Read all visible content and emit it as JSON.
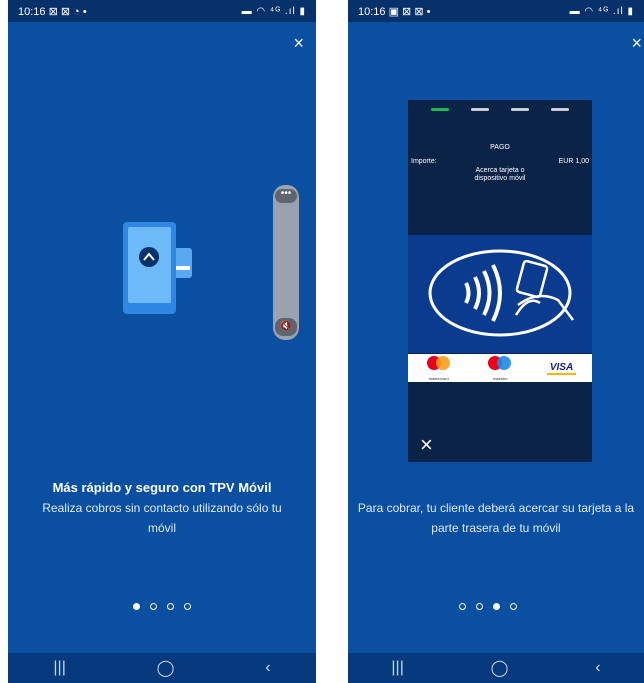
{
  "left": {
    "status": {
      "time": "10:16",
      "left_icons": "⊠ ⊠ ◔ •",
      "right_icons": "▬ ◠ ⁴ᴳ .ıl ▮"
    },
    "title": "Más rápido y seguro con TPV Móvil",
    "subtitle": "Realiza cobros sin contacto utilizando sólo tu móvil",
    "dots": {
      "total": 4,
      "active": 1
    },
    "side_panel": {
      "more_label": "•••",
      "mute_label": "🔇"
    }
  },
  "right": {
    "status": {
      "time": "10:16",
      "left_icons": "▣ ⊠ ⊠ •",
      "right_icons": "▬ ◠ ⁴ᴳ .ıl ▮"
    },
    "terminal": {
      "header": "PAGO",
      "amount_label": "Importe:",
      "amount_value": "EUR 1,00",
      "instruction": "Acerca tarjeta o dispositivo móvil",
      "brands": [
        "mastercard",
        "maestro",
        "VISA"
      ]
    },
    "subtitle": "Para cobrar, tu cliente deberá acercar su tarjeta a la parte trasera de tu móvil",
    "dots": {
      "total": 4,
      "active": 3
    }
  },
  "nav": {
    "recent": "|||",
    "home": "◯",
    "back": "‹"
  },
  "close_label": "×",
  "colors": {
    "background": "#0a4fa0",
    "status_bar": "#06316b",
    "accent_green": "#1db954"
  }
}
